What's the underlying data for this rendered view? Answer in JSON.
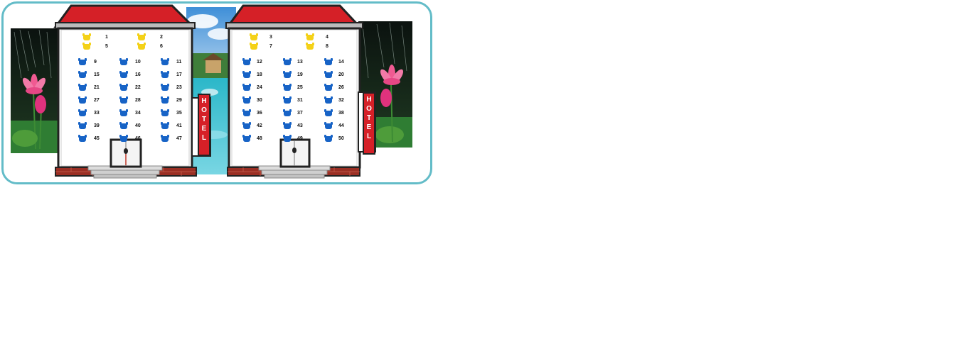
{
  "hotels": [
    {
      "sign": "HOTEL",
      "premium_seats": [
        {
          "number": "1",
          "status": "gold"
        },
        {
          "number": "2",
          "status": "gold"
        },
        {
          "number": "5",
          "status": "gold"
        },
        {
          "number": "6",
          "status": "gold"
        }
      ],
      "rows": [
        [
          "9",
          "10",
          "11"
        ],
        [
          "15",
          "16",
          "17"
        ],
        [
          "21",
          "22",
          "23"
        ],
        [
          "27",
          "28",
          "29"
        ],
        [
          "33",
          "34",
          "35"
        ],
        [
          "39",
          "40",
          "41"
        ],
        [
          "45",
          "46",
          "47"
        ]
      ]
    },
    {
      "sign": "HOTEL",
      "premium_seats": [
        {
          "number": "3",
          "status": "gold"
        },
        {
          "number": "4",
          "status": "gold"
        },
        {
          "number": "7",
          "status": "gold"
        },
        {
          "number": "8",
          "status": "gold"
        }
      ],
      "rows": [
        [
          "12",
          "13",
          "14"
        ],
        [
          "18",
          "19",
          "20"
        ],
        [
          "24",
          "25",
          "26"
        ],
        [
          "30",
          "31",
          "32"
        ],
        [
          "36",
          "37",
          "38"
        ],
        [
          "42",
          "43",
          "44"
        ],
        [
          "48",
          "49",
          "50"
        ]
      ]
    }
  ],
  "colors": {
    "frame": "#63bcc8",
    "roof": "#d52027",
    "seat_regular": "#1763c6",
    "seat_premium": "#f4d117",
    "sign": "#d52027"
  }
}
